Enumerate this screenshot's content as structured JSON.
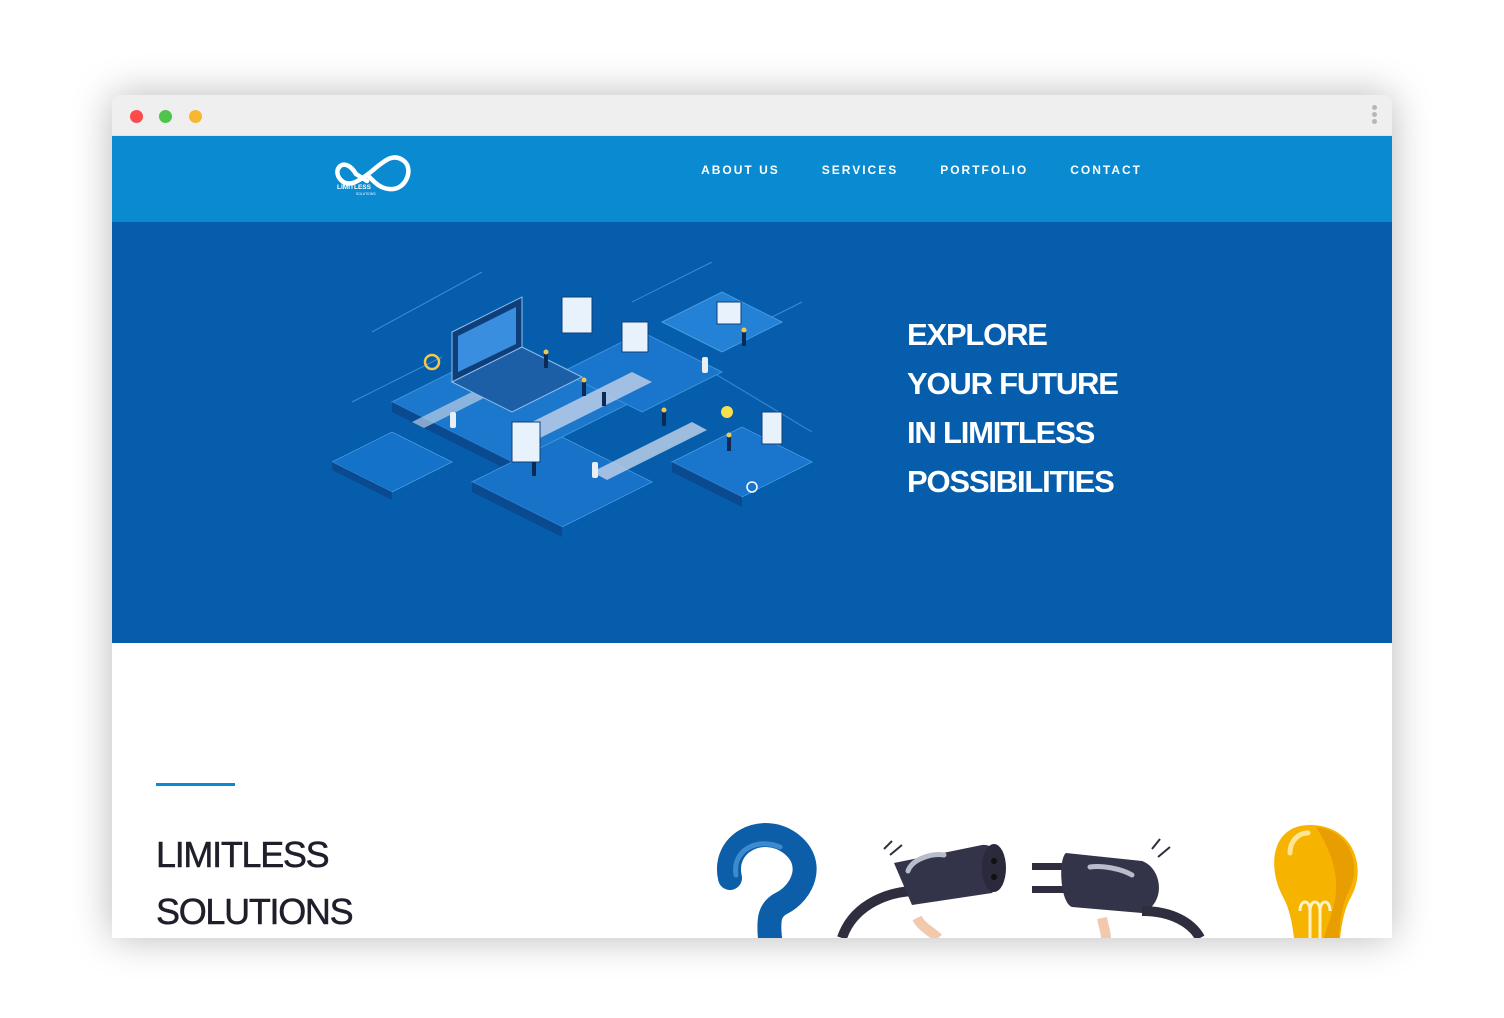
{
  "window": {
    "controls": [
      "close",
      "minimize",
      "zoom"
    ],
    "menu_icon": "more-vertical-icon"
  },
  "brand": {
    "logo_icon": "infinity-logo-icon",
    "logo_text": "LIMITLESS",
    "logo_subtext": "SOLUTIONS"
  },
  "nav": {
    "items": [
      {
        "label": "ABOUT US"
      },
      {
        "label": "SERVICES"
      },
      {
        "label": "PORTFOLIO"
      },
      {
        "label": "CONTACT"
      }
    ]
  },
  "hero": {
    "illustration": "isometric-technology-city-illustration",
    "headline_lines": [
      "EXPLORE",
      "YOUR FUTURE",
      "IN LIMITLESS",
      "POSSIBILITIES"
    ]
  },
  "section": {
    "title_lines": [
      "LIMITLESS",
      "SOLUTIONS"
    ],
    "illustration": "question-plug-lightbulb-illustration"
  },
  "colors": {
    "nav_bg": "#0a8ad0",
    "hero_bg": "#055dab",
    "accent": "#0a8ad0",
    "text_dark": "#1f1f2b"
  }
}
